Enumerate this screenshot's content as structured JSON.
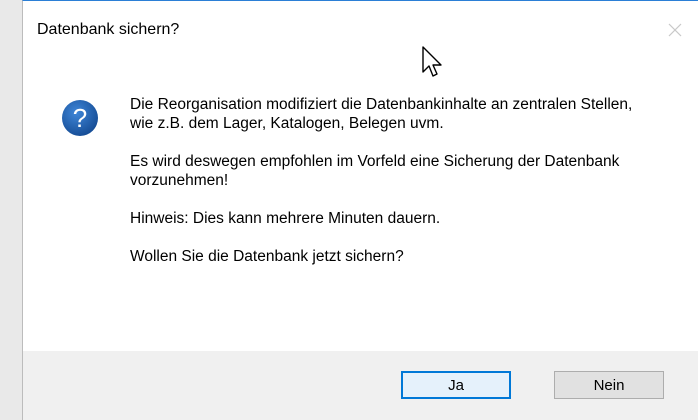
{
  "dialog": {
    "title": "Datenbank sichern?",
    "icon": "question-icon",
    "message": {
      "line1": "Die Reorganisation modifiziert die Datenbankinhalte an zentralen Stellen, wie z.B. dem Lager, Katalogen, Belegen uvm.",
      "line2": "Es wird deswegen empfohlen im Vorfeld eine Sicherung der Datenbank vorzunehmen!",
      "line3": "Hinweis: Dies kann mehrere Minuten dauern.",
      "line4": "Wollen Sie die Datenbank jetzt sichern?"
    },
    "buttons": {
      "yes": "Ja",
      "no": "Nein"
    },
    "colors": {
      "accent": "#0078d7",
      "icon_bg": "#1c5aa6",
      "footer_bg": "#f0f0f0"
    }
  }
}
